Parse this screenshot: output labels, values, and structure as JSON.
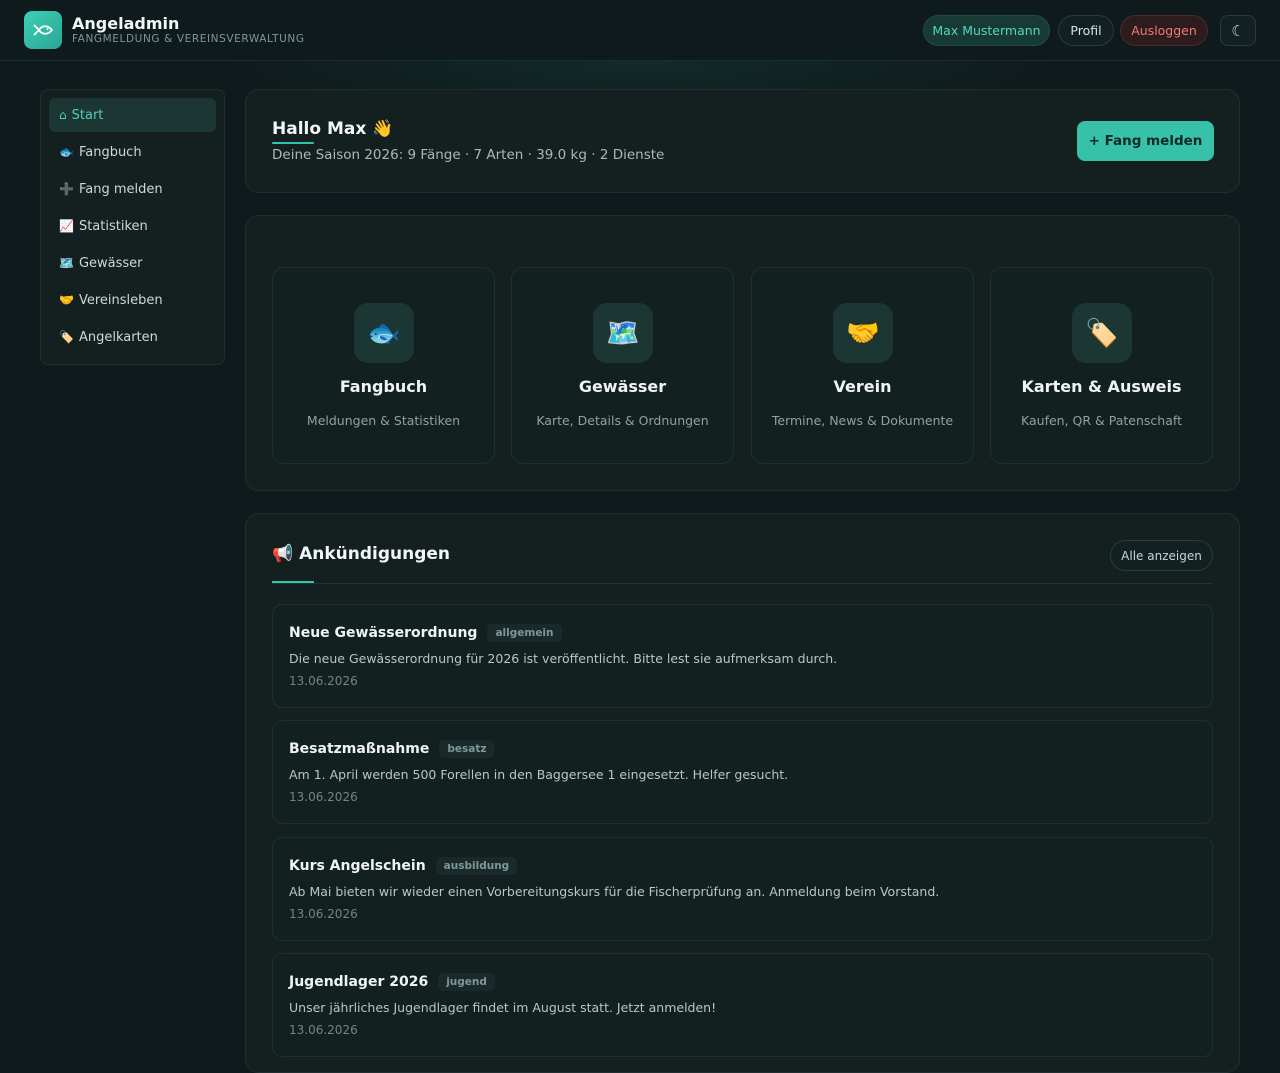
{
  "header": {
    "app_title": "Angeladmin",
    "app_subtitle": "FANGMELDUNG & VEREINSVERWALTUNG",
    "user_name": "Max Mustermann",
    "profile_label": "Profil",
    "logout_label": "Ausloggen",
    "theme_toggle_icon": "☾"
  },
  "sidebar": {
    "items": [
      {
        "icon": "⌂",
        "label": "Start",
        "active": true
      },
      {
        "icon": "🐟",
        "label": "Fangbuch"
      },
      {
        "icon": "➕",
        "label": "Fang melden"
      },
      {
        "icon": "📈",
        "label": "Statistiken"
      },
      {
        "icon": "🗺️",
        "label": "Gewässer"
      },
      {
        "icon": "🤝",
        "label": "Vereinsleben"
      },
      {
        "icon": "🏷️",
        "label": "Angelkarten"
      }
    ]
  },
  "hello": {
    "title": "Hallo Max 👋",
    "subtitle": "Deine Saison 2026: 9 Fänge · 7 Arten · 39.0 kg · 2 Dienste",
    "primary_button": "+ Fang melden"
  },
  "tiles": [
    {
      "icon": "🐟",
      "title": "Fangbuch",
      "subtitle": "Meldungen & Statistiken"
    },
    {
      "icon": "🗺️",
      "title": "Gewässer",
      "subtitle": "Karte, Details & Ordnungen"
    },
    {
      "icon": "🤝",
      "title": "Verein",
      "subtitle": "Termine, News & Dokumente"
    },
    {
      "icon": "🏷️",
      "title": "Karten & Ausweis",
      "subtitle": "Kaufen, QR & Patenschaft"
    }
  ],
  "announcements": {
    "title": "📢 Ankündigungen",
    "all_button": "Alle anzeigen",
    "items": [
      {
        "title": "Neue Gewässerordnung",
        "tag": "allgemein",
        "text": "Die neue Gewässerordnung für 2026 ist veröffentlicht. Bitte lest sie aufmerksam durch.",
        "date": "13.06.2026"
      },
      {
        "title": "Besatzmaßnahme",
        "tag": "besatz",
        "text": "Am 1. April werden 500 Forellen in den Baggersee 1 eingesetzt. Helfer gesucht.",
        "date": "13.06.2026"
      },
      {
        "title": "Kurs Angelschein",
        "tag": "ausbildung",
        "text": "Ab Mai bieten wir wieder einen Vorbereitungskurs für die Fischerprüfung an. Anmeldung beim Vorstand.",
        "date": "13.06.2026"
      },
      {
        "title": "Jugendlager 2026",
        "tag": "jugend",
        "text": "Unser jährliches Jugendlager findet im August statt. Jetzt anmelden!",
        "date": "13.06.2026"
      }
    ]
  },
  "colors": {
    "accent": "#37c1a9",
    "background": "#0f1a1c",
    "card": "#13201f",
    "logout": "#f07a74"
  }
}
